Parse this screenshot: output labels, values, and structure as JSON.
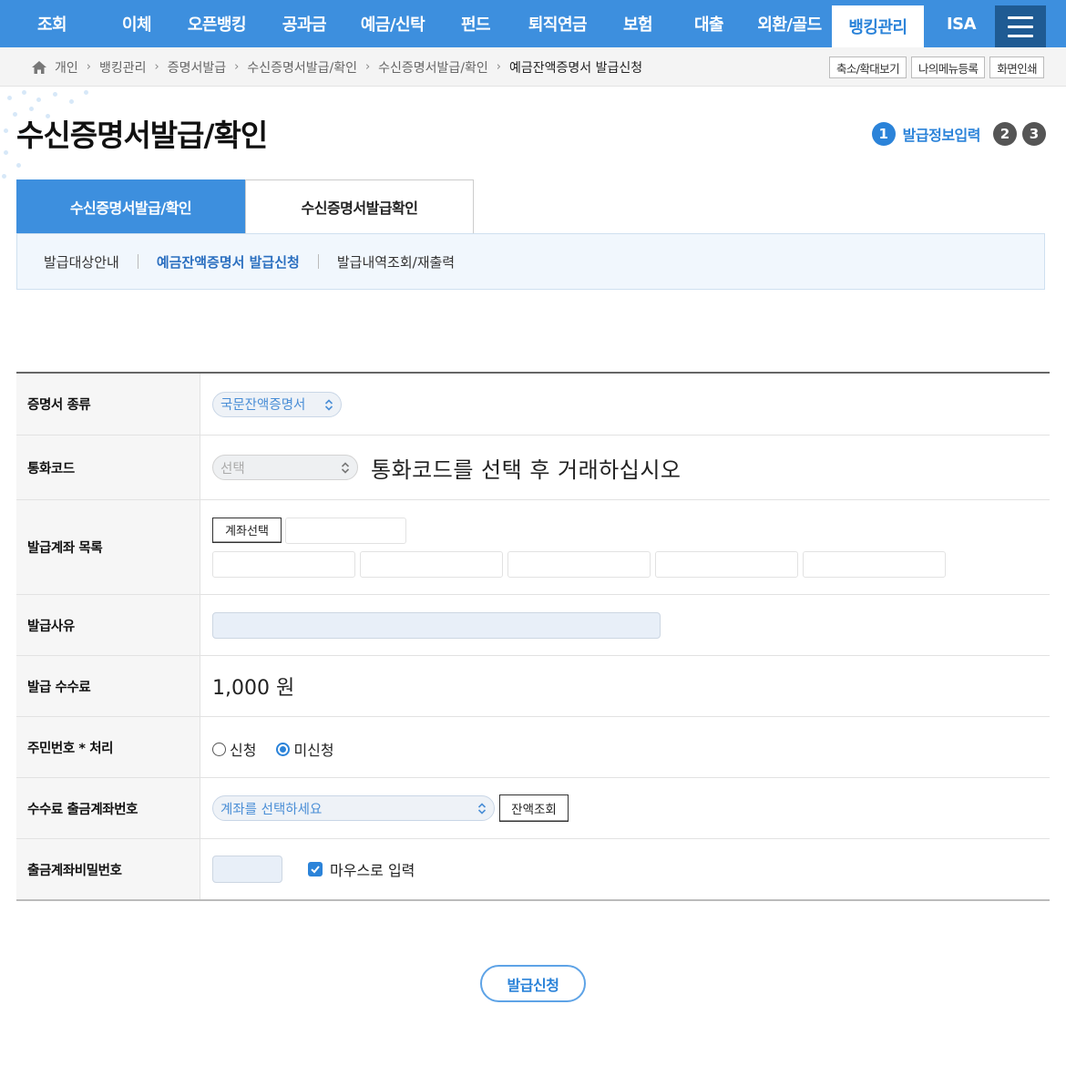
{
  "nav": {
    "items": [
      {
        "label": "조회",
        "active": false
      },
      {
        "label": "이체",
        "active": false
      },
      {
        "label": "오픈뱅킹",
        "active": false
      },
      {
        "label": "공과금",
        "active": false
      },
      {
        "label": "예금/신탁",
        "active": false
      },
      {
        "label": "펀드",
        "active": false
      },
      {
        "label": "퇴직연금",
        "active": false
      },
      {
        "label": "보험",
        "active": false
      },
      {
        "label": "대출",
        "active": false
      },
      {
        "label": "외환/골드",
        "active": false
      },
      {
        "label": "뱅킹관리",
        "active": true
      },
      {
        "label": "ISA",
        "active": false
      }
    ],
    "menu_icon": "hamburger-icon"
  },
  "breadcrumb": {
    "home_icon": "home-icon",
    "items": [
      "개인",
      "뱅킹관리",
      "증명서발급",
      "수신증명서발급/확인",
      "수신증명서발급/확인",
      "예금잔액증명서 발급신청"
    ]
  },
  "util_buttons": [
    "축소/확대보기",
    "나의메뉴등록",
    "화면인쇄"
  ],
  "page": {
    "title": "수신증명서발급/확인",
    "steps": {
      "current": "1",
      "current_label": "발급정보입력",
      "others": [
        "2",
        "3"
      ]
    }
  },
  "tabs": [
    {
      "label": "수신증명서발급/확인",
      "active": true
    },
    {
      "label": "수신증명서발급확인",
      "active": false
    }
  ],
  "subtabs": [
    {
      "label": "발급대상안내",
      "active": false
    },
    {
      "label": "예금잔액증명서 발급신청",
      "active": true
    },
    {
      "label": "발급내역조회/재출력",
      "active": false
    }
  ],
  "form": {
    "cert_type": {
      "label": "증명서 종류",
      "value": "국문잔액증명서"
    },
    "currency": {
      "label": "통화코드",
      "value": "선택",
      "hint": "통화코드를 선택 후 거래하십시오"
    },
    "accounts": {
      "label": "발급계좌 목록",
      "button": "계좌선택"
    },
    "reason": {
      "label": "발급사유"
    },
    "fee": {
      "label": "발급 수수료",
      "value": "1,000 원"
    },
    "rrn": {
      "label": "주민번호 * 처리",
      "option_apply": "신청",
      "option_not_apply": "미신청",
      "selected": "미신청"
    },
    "fee_account": {
      "label": "수수료 출금계좌번호",
      "placeholder": "계좌를 선택하세요",
      "button": "잔액조회"
    },
    "password": {
      "label": "출금계좌비밀번호",
      "mouse_input_label": "마우스로 입력",
      "mouse_input_checked": true
    }
  },
  "submit_label": "발급신청",
  "colors": {
    "primary": "#3d8fde",
    "accent_text": "#2b83d9",
    "nav_menu_bg": "#1f5b93"
  }
}
